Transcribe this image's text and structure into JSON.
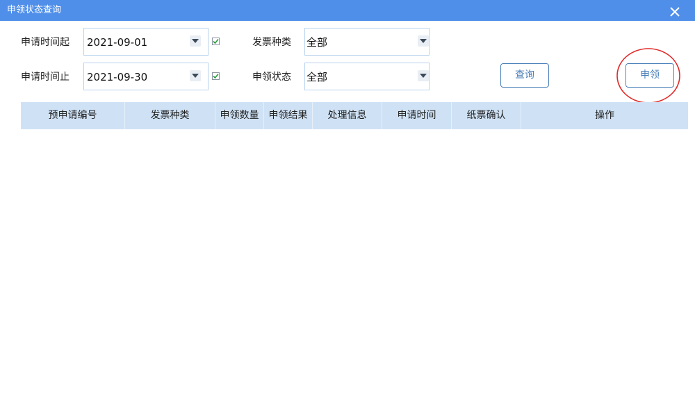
{
  "window": {
    "title": "申领状态查询",
    "close_icon": "close-icon"
  },
  "filters": {
    "start_label": "申请时间起",
    "start_date": "2021-09-01",
    "start_checked": true,
    "end_label": "申请时间止",
    "end_date": "2021-09-30",
    "end_checked": true,
    "invoice_type_label": "发票种类",
    "invoice_type_value": "全部",
    "status_label": "申领状态",
    "status_value": "全部"
  },
  "buttons": {
    "query": "查询",
    "apply": "申领"
  },
  "highlight": {
    "color": "#e02b2b"
  },
  "table": {
    "columns": [
      "预申请编号",
      "发票种类",
      "申领数量",
      "申领结果",
      "处理信息",
      "申请时间",
      "纸票确认",
      "操作"
    ],
    "rows": []
  },
  "colors": {
    "titlebar": "#4f8fea",
    "header_bg": "#cfe2f5",
    "button_border": "#4a7fb8"
  }
}
